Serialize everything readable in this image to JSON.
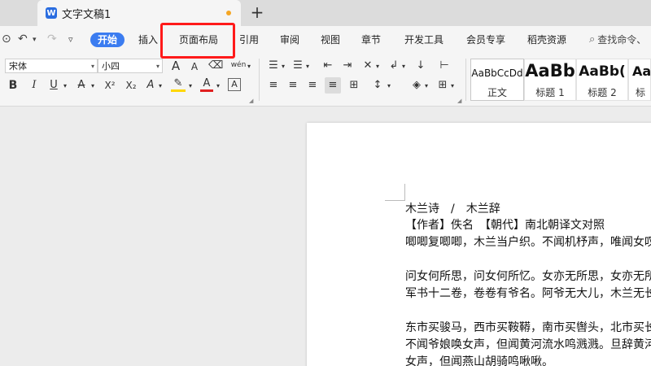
{
  "tabbar": {
    "doc_logo": "W",
    "doc_title": "文字文稿1",
    "new_tab_icon": "+"
  },
  "quick_access": {
    "preview_icon": "⊙",
    "undo_icon": "↶",
    "undo_dropdown": "▾",
    "redo_icon": "↷",
    "more_icon": "▿"
  },
  "menu_tabs": [
    {
      "label": "开始",
      "active": true
    },
    {
      "label": "插入"
    },
    {
      "label": "页面布局"
    },
    {
      "label": "引用"
    },
    {
      "label": "审阅"
    },
    {
      "label": "视图"
    },
    {
      "label": "章节"
    },
    {
      "label": "开发工具"
    },
    {
      "label": "会员专享"
    },
    {
      "label": "稻壳资源"
    }
  ],
  "search": {
    "icon": "⌕",
    "label": "查找命令、"
  },
  "font": {
    "family": "宋体",
    "size": "小四",
    "dropdown": "▾"
  },
  "tool_glyphs": {
    "grow_font": "A",
    "shrink_font": "A",
    "clear_format": "⌫",
    "pinyin": "wén",
    "bold": "B",
    "italic": "I",
    "underline": "U",
    "strikethrough": "A",
    "superscript": "X²",
    "subscript": "X₂",
    "text_effect": "A",
    "highlight": "✎",
    "font_color": "A",
    "char_border": "A",
    "bullets": "☰",
    "numbering": "☰",
    "decrease_indent": "⇤",
    "increase_indent": "⇥",
    "chinese_layout": "✕",
    "text_direction": "↲",
    "tabs": "⊢",
    "align_left": "≡",
    "align_center": "≡",
    "align_right": "≡",
    "justify": "≡",
    "distributed": "⊞",
    "line_spacing": "↕",
    "sort": "↓",
    "shading": "◈",
    "borders": "⊞",
    "dropdown": "▾"
  },
  "styles": [
    {
      "preview": "AaBbCcDd",
      "name": "正文"
    },
    {
      "preview": "AaBb",
      "name": "标题 1"
    },
    {
      "preview": "AaBb(",
      "name": "标题 2"
    },
    {
      "preview": "Aa",
      "name": "标"
    }
  ],
  "colors": {
    "accent": "#3b7cf0",
    "highlight_red": "#ff1a1a",
    "unsaved_dot": "#f5a623",
    "highlight_bar": "#ffd700",
    "font_color_bar": "#e02020"
  },
  "document": {
    "lines": [
      "木兰诗　/　木兰辞",
      "【作者】佚名　【朝代】南北朝译文对照",
      "唧唧复唧唧，木兰当户织。不闻机杼声，唯闻女叹息。",
      "",
      "问女何所思，问女何所忆。女亦无所思，女亦无所忆。昨夜见",
      "军书十二卷，卷卷有爷名。阿爷无大儿，木兰无长兄，愿为市",
      "",
      "东市买骏马，西市买鞍鞯，南市买辔头，北市买长鞭。旦辞爷",
      "不闻爷娘唤女声，但闻黄河流水鸣溅溅。旦辞黄河去，暮至黑",
      "女声，但闻燕山胡骑鸣啾啾。"
    ]
  }
}
